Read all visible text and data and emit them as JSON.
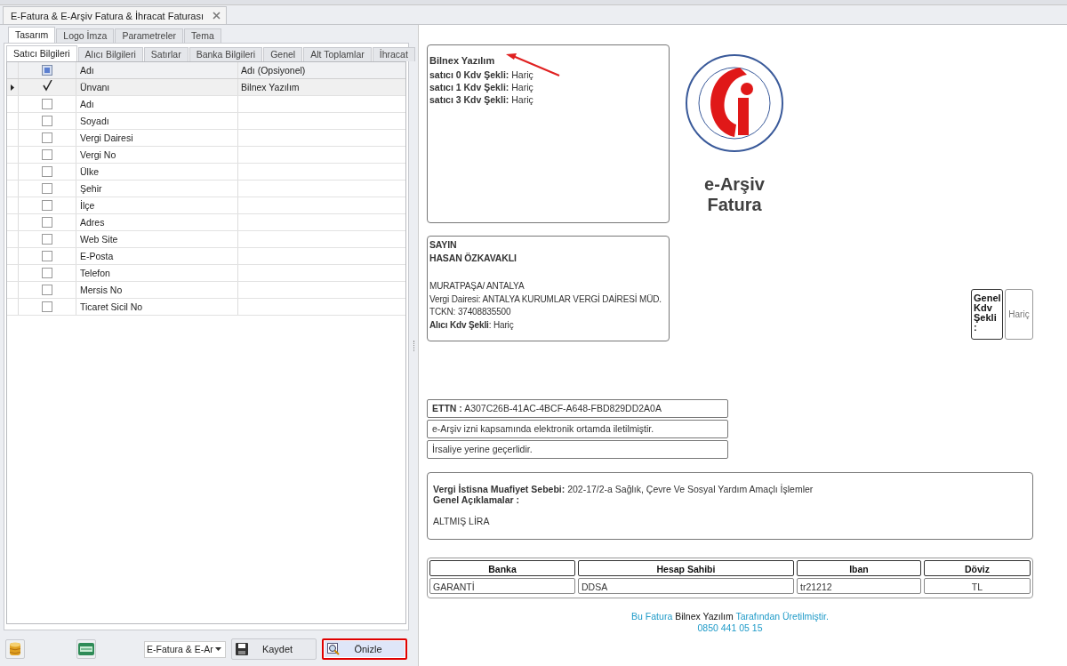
{
  "document_tab": {
    "title": "E-Fatura & E-Arşiv Fatura & İhracat Faturası"
  },
  "outer_tabs": [
    {
      "label": "Tasarım",
      "selected": true
    },
    {
      "label": "Logo  İmza",
      "selected": false
    },
    {
      "label": "Parametreler",
      "selected": false
    },
    {
      "label": "Tema",
      "selected": false
    }
  ],
  "inner_tabs": [
    {
      "label": "Satıcı Bilgileri",
      "selected": true
    },
    {
      "label": "Alıcı Bilgileri",
      "selected": false
    },
    {
      "label": "Satırlar",
      "selected": false
    },
    {
      "label": "Banka Bilgileri",
      "selected": false
    },
    {
      "label": "Genel",
      "selected": false
    },
    {
      "label": "Alt Toplamlar",
      "selected": false
    },
    {
      "label": "İhracat",
      "selected": false
    }
  ],
  "grid": {
    "columns": [
      "Adı",
      "Adı (Opsiyonel)"
    ],
    "header_indeterminate": true,
    "rows": [
      {
        "field": "Ünvanı",
        "optional": "Bilnex Yazılım",
        "checked": true,
        "selected": true
      },
      {
        "field": "Adı",
        "checked": false,
        "selected": false
      },
      {
        "field": "Soyadı",
        "checked": false,
        "selected": false
      },
      {
        "field": "Vergi Dairesi",
        "checked": false,
        "selected": false
      },
      {
        "field": "Vergi No",
        "checked": false,
        "selected": false
      },
      {
        "field": "Ülke",
        "checked": false,
        "selected": false
      },
      {
        "field": "Şehir",
        "checked": false,
        "selected": false
      },
      {
        "field": "İlçe",
        "checked": false,
        "selected": false
      },
      {
        "field": "Adres",
        "checked": false,
        "selected": false
      },
      {
        "field": "Web Site",
        "checked": false,
        "selected": false
      },
      {
        "field": "E-Posta",
        "checked": false,
        "selected": false
      },
      {
        "field": "Telefon",
        "checked": false,
        "selected": false
      },
      {
        "field": "Mersis No",
        "checked": false,
        "selected": false
      },
      {
        "field": "Ticaret Sicil No",
        "checked": false,
        "selected": false
      }
    ]
  },
  "bottom_bar": {
    "template_select": "E-Fatura & E-Ar",
    "buttons": [
      {
        "label": "Kaydet",
        "kind": "save",
        "highlighted": false
      },
      {
        "label": "Önizle",
        "kind": "preview",
        "highlighted": true
      }
    ]
  },
  "preview": {
    "seller": {
      "name": "Bilnex Yazılım",
      "lines": [
        "**satıcı 0 Kdv Şekli:** Hariç",
        "**satıcı 1 Kdv Şekli:** Hariç",
        "**satıcı 3 Kdv Şekli:** Hariç"
      ]
    },
    "title_lines": [
      "e-Arşiv",
      "Fatura"
    ],
    "buyer": {
      "heading": "SAYIN",
      "name": "HASAN ÖZKAVAKLI",
      "lines": [
        "MURATPAŞA/ ANTALYA",
        "Vergi Dairesi: ANTALYA KURUMLAR VERGİ DAİRESİ MÜD.",
        "TCKN: 37408835500"
      ],
      "kdv": "**Alıcı Kdv Şekli**: Hariç"
    },
    "general_kdv": {
      "label": "Genel Kdv Şekli :",
      "value": "Hariç"
    },
    "notices": [
      "**ETTN :** A307C26B-41AC-4BCF-A648-FBD829DD2A0A",
      "e-Arşiv izni kapsamında elektronik ortamda iletilmiştir.",
      "İrsaliye yerine geçerlidir."
    ],
    "notes": {
      "exemption": "**Vergi İstisna Muafiyet Sebebi:** 202-17/2-a Sağlık, Çevre Ve Sosyal Yardım Amaçlı İşlemler",
      "general_label": "Genel Açıklamalar :",
      "amount_text": "ALTMIŞ LİRA"
    },
    "bank_table": {
      "columns": [
        "Banka",
        "Hesap Sahibi",
        "Iban",
        "Döviz"
      ],
      "rows": [
        [
          "GARANTİ",
          "DDSA",
          "tr21212",
          "TL"
        ]
      ]
    },
    "footer": {
      "parts": [
        {
          "text": "Bu Fatura",
          "kind": "accent"
        },
        {
          "text": "Bilnex Yazılım",
          "kind": "plain"
        },
        {
          "text": "Tarafından Üretilmiştir.",
          "kind": "accent"
        }
      ],
      "phone": "0850 441 05 15"
    }
  }
}
